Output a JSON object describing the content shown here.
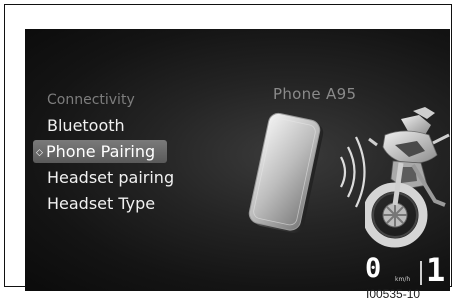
{
  "menu": {
    "header": "Connectivity",
    "items": [
      {
        "label": "Bluetooth",
        "selected": false
      },
      {
        "label": "Phone Pairing",
        "selected": true
      },
      {
        "label": "Headset pairing",
        "selected": false
      },
      {
        "label": "Headset Type",
        "selected": false
      }
    ],
    "selection_indicator": "◇"
  },
  "device": {
    "name": "Phone A95"
  },
  "status": {
    "speed": "0",
    "speed_unit": "km/h",
    "gear": "1"
  },
  "figure": {
    "id": "I00535-10"
  },
  "icons": {
    "phone": "smartphone-icon",
    "signal": "wireless-signal-icon",
    "bike": "motorcycle-illustration"
  },
  "colors": {
    "screen_background": "#141414",
    "menu_header": "#7d7d7d",
    "menu_text": "#f1f1f1",
    "selection_highlight": "#6a6a6a"
  }
}
